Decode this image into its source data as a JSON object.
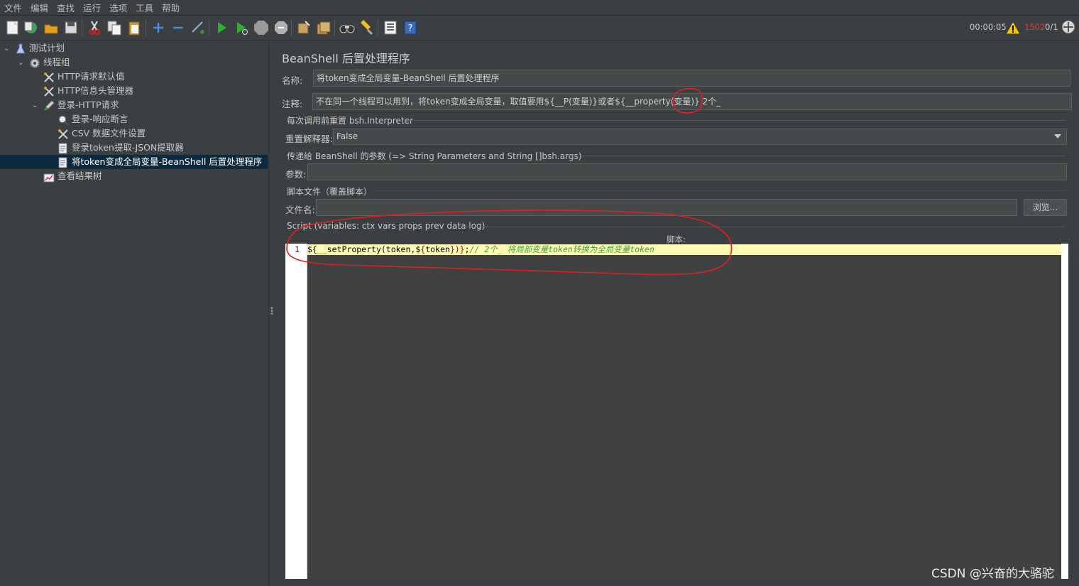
{
  "menu": [
    "文件",
    "编辑",
    "查找",
    "运行",
    "选项",
    "工具",
    "帮助"
  ],
  "status": {
    "timer": "00:00:05",
    "warning_count": "1502",
    "threads": "0/1"
  },
  "tree": {
    "nodes": [
      {
        "label": "测试计划",
        "icon": "flask-icon"
      },
      {
        "label": "线程组",
        "icon": "gear-icon"
      },
      {
        "label": "HTTP请求默认值",
        "icon": "tools-icon"
      },
      {
        "label": "HTTP信息头管理器",
        "icon": "tools-icon"
      },
      {
        "label": "登录-HTTP请求",
        "icon": "pencil-icon"
      },
      {
        "label": "登录-响应断言",
        "icon": "magnifier-icon"
      },
      {
        "label": "CSV 数据文件设置",
        "icon": "tools-icon"
      },
      {
        "label": "登录token提取-JSON提取器",
        "icon": "document-icon"
      },
      {
        "label": "将token变成全局变量-BeanShell 后置处理程序",
        "icon": "document-icon"
      },
      {
        "label": "查看结果树",
        "icon": "chart-icon"
      }
    ]
  },
  "panel": {
    "title": "BeanShell 后置处理程序",
    "name_label": "名称:",
    "name_value": "将token变成全局变量-BeanShell 后置处理程序",
    "comment_label": "注释:",
    "comment_value": "不在同一个线程可以用到，将token变成全局变量，取值要用${__P(变量)}或者${__property(变量)}",
    "comment_note": "2个_",
    "reset_group": "每次调用前重置 bsh.Interpreter",
    "reset_label": "重置解释器:",
    "reset_value": "False",
    "params_group": "传递给 BeanShell 的参数 (=> String Parameters and String []bsh.args)",
    "params_label": "参数:",
    "params_value": "",
    "file_group": "脚本文件（覆盖脚本）",
    "file_label": "文件名:",
    "file_value": "",
    "browse_label": "浏览...",
    "script_group": "Script (variables: ctx vars props prev data log)",
    "script_label": "脚本:",
    "line_number": "1",
    "code_open": "${",
    "code_func": "__setProperty(token,$",
    "code_open2": "{",
    "code_mid": "token",
    "code_close": "})}",
    "code_semicolon": ";",
    "code_comment": "// 2个_ 将局部变量token转换为全局变量token"
  },
  "watermark": "CSDN @兴奋的大骆驼",
  "colors": {
    "background": "#3c3f41",
    "selection": "#0d293e",
    "annotation": "#e02020",
    "code_highlight": "#fefcb4"
  }
}
